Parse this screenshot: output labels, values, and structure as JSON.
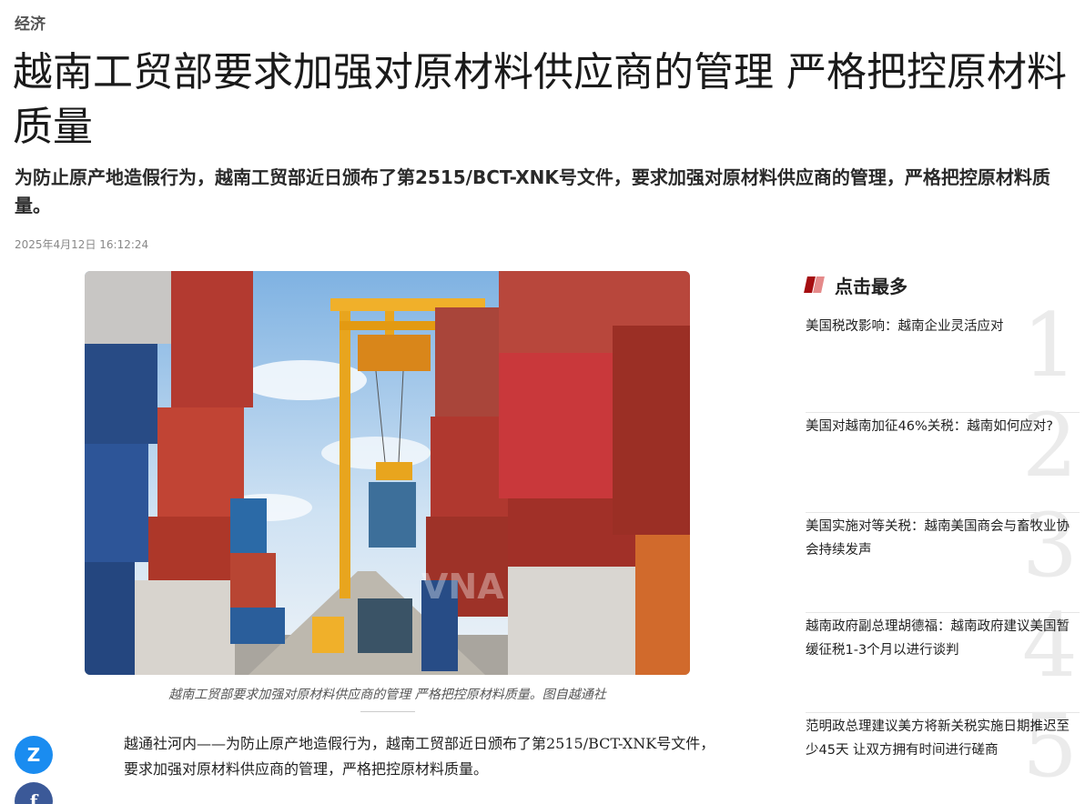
{
  "article": {
    "category": "经济",
    "title": "越南工贸部要求加强对原材料供应商的管理 严格把控原材料质量",
    "summary": "为防止原产地造假行为，越南工贸部近日颁布了第2515/BCT-XNK号文件，要求加强对原材料供应商的管理，严格把控原材料质量。",
    "timestamp": "2025年4月12日 16:12:24",
    "image_caption": "越南工贸部要求加强对原材料供应商的管理 严格把控原材料质量。图自越通社",
    "image_watermark": "VNA",
    "body": "越通社河内——为防止原产地造假行为，越南工贸部近日颁布了第2515/BCT-XNK号文件，要求加强对原材料供应商的管理，严格把控原材料质量。"
  },
  "share": {
    "zalo_label": "Z",
    "facebook_label": "f"
  },
  "sidebar": {
    "title": "点击最多",
    "items": [
      {
        "rank": "1",
        "text": "美国税改影响：越南企业灵活应对"
      },
      {
        "rank": "2",
        "text": "美国对越南加征46%关税：越南如何应对?"
      },
      {
        "rank": "3",
        "text": "美国实施对等关税：越南美国商会与畜牧业协会持续发声"
      },
      {
        "rank": "4",
        "text": "越南政府副总理胡德福：越南政府建议美国暂缓征税1-3个月以进行谈判"
      },
      {
        "rank": "5",
        "text": "范明政总理建议美方将新关税实施日期推迟至少45天 让双方拥有时间进行磋商"
      }
    ]
  }
}
